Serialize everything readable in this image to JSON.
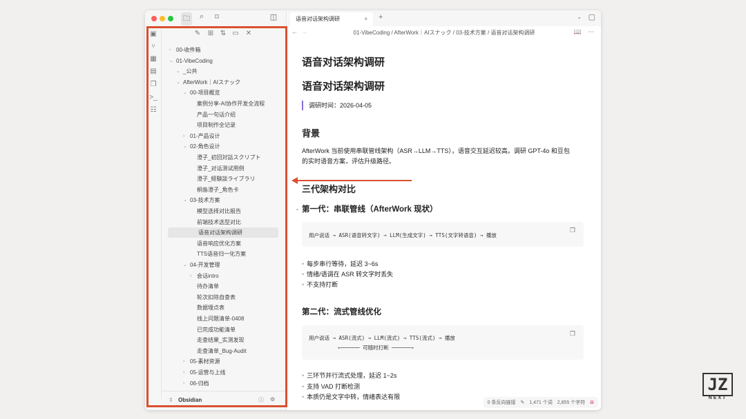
{
  "sidebar": {
    "tree": [
      {
        "label": "00-收件箱",
        "level": 0,
        "type": "folder",
        "open": false
      },
      {
        "label": "01-VibeCoding",
        "level": 0,
        "type": "folder",
        "open": true
      },
      {
        "label": "_公共",
        "level": 1,
        "type": "folder",
        "open": true
      },
      {
        "label": "AfterWork｜AIスナック",
        "level": 1,
        "type": "folder",
        "open": true
      },
      {
        "label": "00-项目概览",
        "level": 2,
        "type": "folder",
        "open": true
      },
      {
        "label": "案例分享-AI协作开发全流程",
        "level": 3,
        "type": "file"
      },
      {
        "label": "产品一句话介绍",
        "level": 3,
        "type": "file"
      },
      {
        "label": "项目制作全记录",
        "level": 3,
        "type": "file"
      },
      {
        "label": "01-产品设计",
        "level": 2,
        "type": "folder",
        "open": false
      },
      {
        "label": "02-角色设计",
        "level": 2,
        "type": "folder",
        "open": true
      },
      {
        "label": "澄子_初回対話スクリプト",
        "level": 3,
        "type": "file"
      },
      {
        "label": "澄子_对话测试用例",
        "level": 3,
        "type": "file"
      },
      {
        "label": "澄子_経験談ライブラリ",
        "level": 3,
        "type": "file"
      },
      {
        "label": "桐島澄子_角色卡",
        "level": 3,
        "type": "file"
      },
      {
        "label": "03-技术方案",
        "level": 2,
        "type": "folder",
        "open": true
      },
      {
        "label": "模型选择对比报告",
        "level": 3,
        "type": "file"
      },
      {
        "label": "前端技术选型对比",
        "level": 3,
        "type": "file"
      },
      {
        "label": "语音对话架构调研",
        "level": 3,
        "type": "file",
        "selected": true
      },
      {
        "label": "语音响应优化方案",
        "level": 3,
        "type": "file"
      },
      {
        "label": "TTS语音归一化方案",
        "level": 3,
        "type": "file"
      },
      {
        "label": "04-开发管理",
        "level": 2,
        "type": "folder",
        "open": true
      },
      {
        "label": "会话intro",
        "level": 3,
        "type": "folder",
        "open": false
      },
      {
        "label": "待办清单",
        "level": 3,
        "type": "file"
      },
      {
        "label": "轮次扣除自查表",
        "level": 3,
        "type": "file"
      },
      {
        "label": "数据埋点表",
        "level": 3,
        "type": "file"
      },
      {
        "label": "线上问题清单-0408",
        "level": 3,
        "type": "file"
      },
      {
        "label": "已完成功能清单",
        "level": 3,
        "type": "file"
      },
      {
        "label": "走查结果_实测发现",
        "level": 3,
        "type": "file"
      },
      {
        "label": "走查清单_Bug-Audit",
        "level": 3,
        "type": "file"
      },
      {
        "label": "05-素材资源",
        "level": 2,
        "type": "folder",
        "open": false
      },
      {
        "label": "05-运营与上线",
        "level": 2,
        "type": "folder",
        "open": false
      },
      {
        "label": "06-归档",
        "level": 2,
        "type": "folder",
        "open": false
      }
    ],
    "vault_name": "Obsidian"
  },
  "tab": {
    "title": "语音对话架构调研",
    "new_tab": "+",
    "close": "×"
  },
  "breadcrumb": "01-VibeCoding / AfterWork｜AIスナック / 03-技术方案 / 语音对话架构调研",
  "doc": {
    "inline_title": "语音对话架构调研",
    "h1": "语音对话架构调研",
    "quote": "调研时间：2026-04-05",
    "h_bg": "背景",
    "bg_line1": "AfterWork 当前使用串联管线架构（ASR→LLM→TTS），语音交互延迟较高。调研 GPT-4o 和豆包",
    "bg_line2": "的实时语音方案，评估升级路径。",
    "h_compare": "三代架构对比",
    "gen1_title": "第一代：串联管线（AfterWork 现状）",
    "gen1_code": "用户说话 → ASR(语音转文字) → LLM(生成文字) → TTS(文字转语音) → 播放",
    "gen1_bullets": [
      "每步串行等待，延迟 3~6s",
      "情绪/语调在 ASR 转文字时丢失",
      "不支持打断"
    ],
    "gen2_title": "第二代：流式管线优化",
    "gen2_code": "用户说话 → ASR(流式) → LLM(流式) → TTS(流式) → 播放",
    "gen2_code2": "←──────  可随时打断  ──────→",
    "gen2_bullets": [
      "三环节并行流式处理，延迟 1~2s",
      "支持 VAD 打断检测",
      "本质仍是文字中转，情绪表达有限"
    ]
  },
  "status": {
    "backlinks": "0 条反向链接",
    "words": "1,471 个词",
    "chars": "2,855 个字符"
  },
  "logo": {
    "text": "JZ",
    "sub": "NEXT"
  },
  "colors": {
    "highlight": "#d9502f",
    "quote_bar": "#8a6fd6"
  }
}
